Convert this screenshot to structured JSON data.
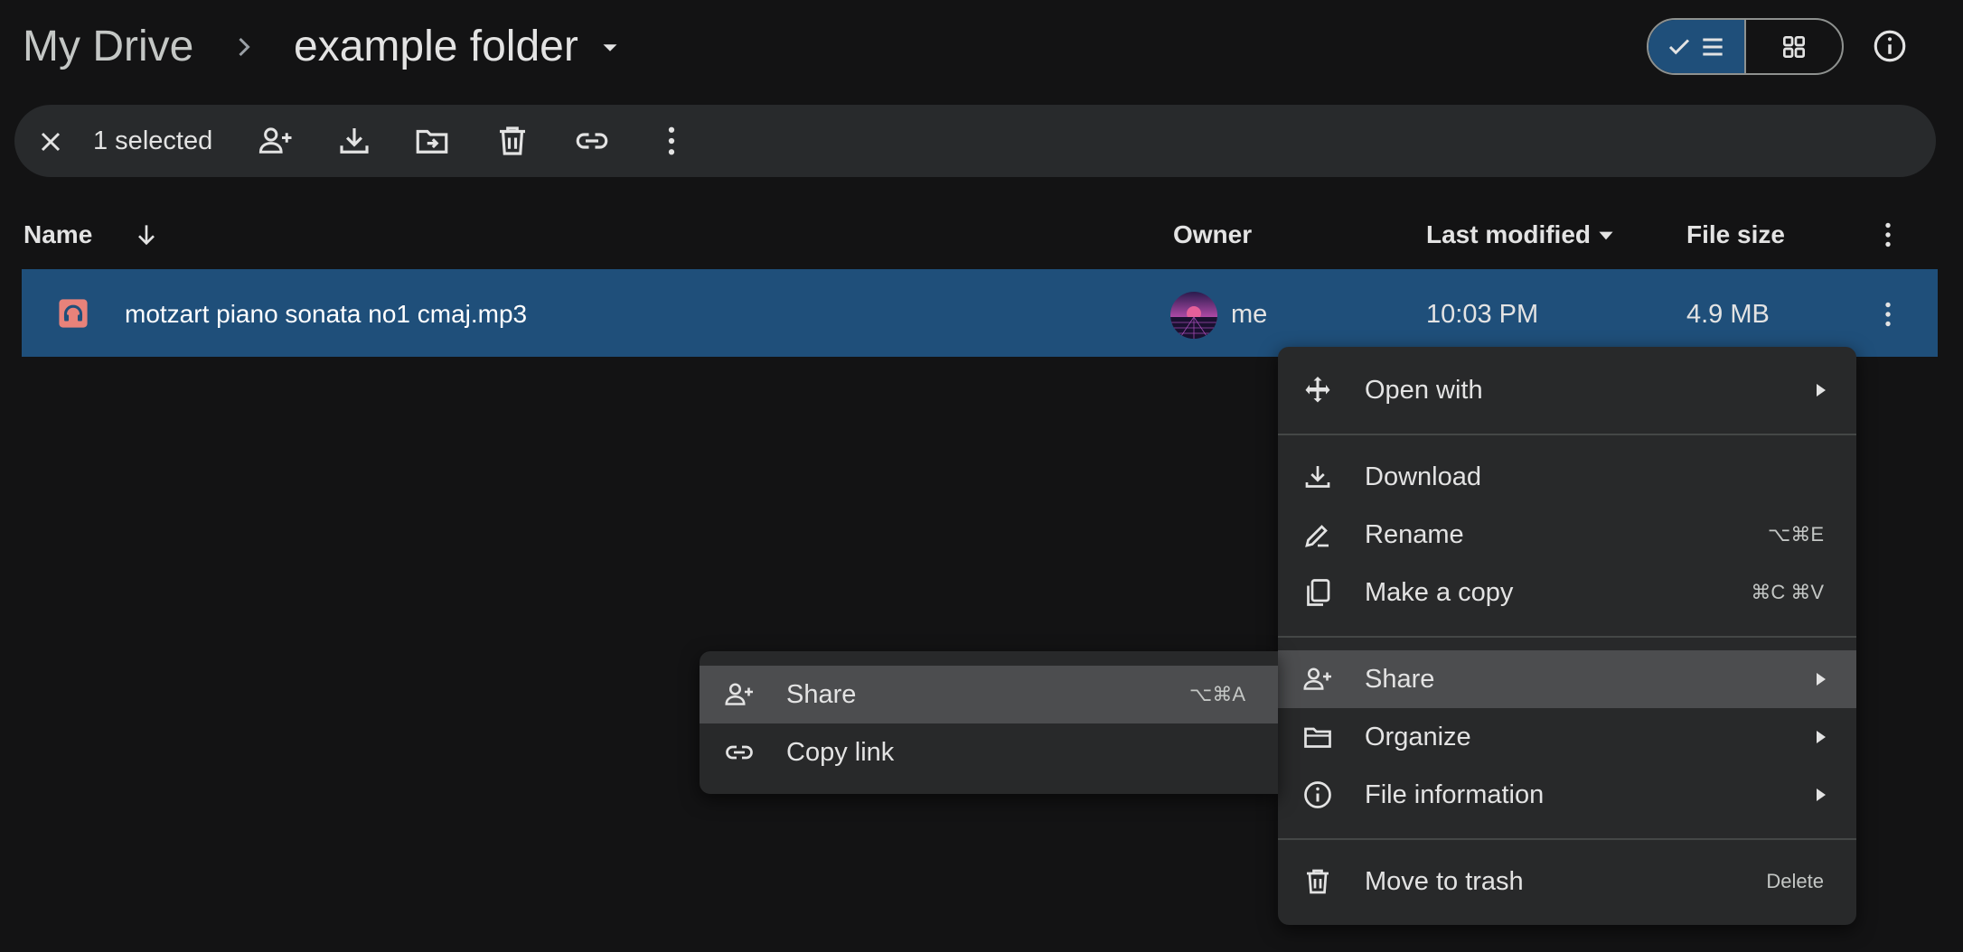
{
  "breadcrumb": {
    "root": "My Drive",
    "current": "example folder"
  },
  "toolbar": {
    "selected_count": "1 selected"
  },
  "columns": {
    "name": "Name",
    "owner": "Owner",
    "last_modified": "Last modified",
    "file_size": "File size"
  },
  "file": {
    "name": "motzart piano sonata no1 cmaj.mp3",
    "owner": "me",
    "modified": "10:03 PM",
    "size": "4.9 MB"
  },
  "context_menu": {
    "items": [
      {
        "label": "Open with",
        "shortcut": "",
        "has_submenu": true,
        "icon": "open-with-icon"
      },
      {
        "label": "Download",
        "shortcut": "",
        "has_submenu": false,
        "icon": "download-icon"
      },
      {
        "label": "Rename",
        "shortcut": "⌥⌘E",
        "has_submenu": false,
        "icon": "rename-icon"
      },
      {
        "label": "Make a copy",
        "shortcut": "⌘C ⌘V",
        "has_submenu": false,
        "icon": "copy-icon"
      },
      {
        "label": "Share",
        "shortcut": "",
        "has_submenu": true,
        "icon": "share-icon",
        "highlighted": true
      },
      {
        "label": "Organize",
        "shortcut": "",
        "has_submenu": true,
        "icon": "folder-icon"
      },
      {
        "label": "File information",
        "shortcut": "",
        "has_submenu": true,
        "icon": "info-icon"
      },
      {
        "label": "Move to trash",
        "shortcut": "Delete",
        "has_submenu": false,
        "icon": "trash-icon"
      }
    ]
  },
  "share_submenu": {
    "items": [
      {
        "label": "Share",
        "shortcut": "⌥⌘A",
        "icon": "share-icon",
        "highlighted": true
      },
      {
        "label": "Copy link",
        "shortcut": "",
        "icon": "link-icon"
      }
    ]
  },
  "colors": {
    "background": "#131314",
    "selection": "#1f4f7a",
    "menu_bg": "#28292a",
    "menu_highlight": "#4c4d4f",
    "audio_icon": "#e8827a"
  }
}
